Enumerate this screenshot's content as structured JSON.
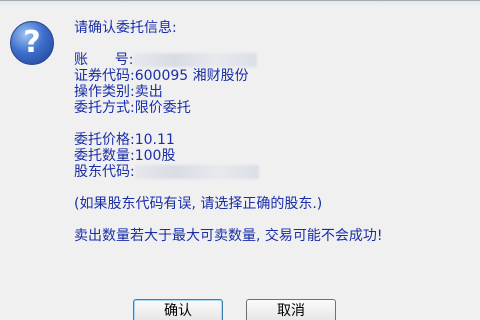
{
  "dialog": {
    "icon": "question-icon",
    "header": "请确认委托信息:",
    "fields": {
      "account_label": "账      号:",
      "security_label": "证券代码:",
      "security_value": "600095 湘财股份",
      "operation_label": "操作类别:",
      "operation_value": "卖出",
      "order_type_label": "委托方式:",
      "order_type_value": "限价委托",
      "price_label": "委托价格:",
      "price_value": "10.11",
      "quantity_label": "委托数量:",
      "quantity_value": "100股",
      "holder_label": "股东代码:"
    },
    "note": "(如果股东代码有误, 请选择正确的股东.)",
    "warning": "卖出数量若大于最大可卖数量, 交易可能不会成功!",
    "buttons": {
      "confirm": "确认",
      "cancel": "取消"
    }
  }
}
